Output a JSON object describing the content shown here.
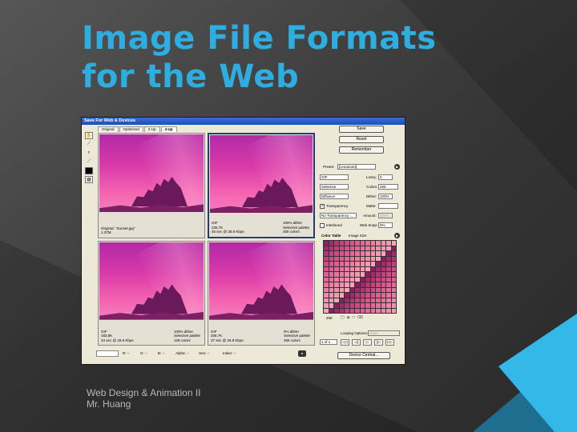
{
  "slide": {
    "title_line1": "Image File Formats",
    "title_line2": "for the Web",
    "footer_line1": "Web Design & Animation II",
    "footer_line2": "Mr. Huang"
  },
  "dialog": {
    "title": "Save For Web & Devices",
    "tabs": [
      "Original",
      "Optimized",
      "2-Up",
      "4-Up"
    ],
    "panes": [
      {
        "left": "Original: \"Sunset.jpg\"\n1.37M",
        "right": ""
      },
      {
        "left": "GIF\n235.7K\n45 sec @ 28.8 Kbps",
        "right": "100% dither\nSelective palette\n256 colors"
      },
      {
        "left": "GIF\n183.8K\n34 sec @ 28.8 Kbps",
        "right": "100% dither\nSelective palette\n128 colors"
      },
      {
        "left": "GIF\n206.7K\n37 sec @ 28.8 Kbps",
        "right": "0% dither\nSelective palette\n256 colors"
      }
    ],
    "status": {
      "zoom": "",
      "r": "R: --",
      "g": "G: --",
      "b": "B: --",
      "alpha": "Alpha: --",
      "hex": "Hex: --",
      "index": "Index: --"
    },
    "buttons": {
      "save": "Save",
      "reset": "Reset",
      "remember": "Remember",
      "device_central": "Device Central..."
    },
    "settings": {
      "preset_label": "Preset:",
      "preset_value": "[Unnamed]",
      "format": "GIF",
      "lossy_label": "Lossy:",
      "lossy_value": "0",
      "reduction": "Selective",
      "colors_label": "Colors:",
      "colors_value": "256",
      "dither_algo": "Diffusion",
      "dither_label": "Dither:",
      "dither_value": "100%",
      "transparency_label": "Transparency",
      "matte_label": "Matte:",
      "transparency_dither": "No Transparency ...",
      "amount_label": "Amount:",
      "amount_value": "100%",
      "interlaced_label": "Interlaced",
      "websnap_label": "Web Snap:",
      "websnap_value": "0%"
    },
    "color_table": {
      "tab1": "Color Table",
      "tab2": "Image Size",
      "count": "256",
      "icons": [
        "lock-icon",
        "web-icon",
        "new-icon",
        "trash-icon"
      ],
      "swatches": [
        "#8a1f5a",
        "#a02a6a",
        "#b33575",
        "#c5407f",
        "#d04a85",
        "#d8548c",
        "#e05e92",
        "#e46897",
        "#e8729c",
        "#ec7ca2",
        "#f086a8",
        "#f490ae",
        "#f69ab4",
        "#f8a4ba"
      ]
    },
    "animation": {
      "looping_label": "Looping Options:",
      "looping_value": "Once",
      "frame_counter": "1 of 1",
      "nav": [
        "◁◁",
        "◁|",
        "▷",
        "|▷",
        "▷▷"
      ]
    }
  }
}
